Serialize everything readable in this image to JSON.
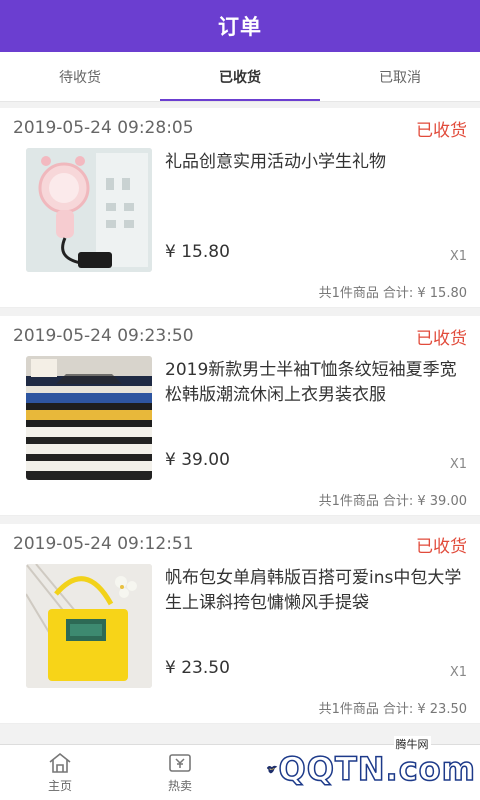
{
  "header": {
    "title": "订单"
  },
  "tabs": [
    {
      "label": "待收货",
      "active": false
    },
    {
      "label": "已收货",
      "active": true
    },
    {
      "label": "已取消",
      "active": false
    }
  ],
  "orders": [
    {
      "time": "2019-05-24 09:28:05",
      "status": "已收货",
      "product_name": "礼品创意实用活动小学生礼物",
      "price": "¥ 15.80",
      "quantity": "X1",
      "summary_count": "共1件商品",
      "summary_total": "合计: ¥ 15.80",
      "image": "usb-fan-product-icon"
    },
    {
      "time": "2019-05-24 09:23:50",
      "status": "已收货",
      "product_name": "2019新款男士半袖T恤条纹短袖夏季宽松韩版潮流休闲上衣男装衣服",
      "price": "¥ 39.00",
      "quantity": "X1",
      "summary_count": "共1件商品",
      "summary_total": "合计: ¥ 39.00",
      "image": "striped-tshirts-product-icon"
    },
    {
      "time": "2019-05-24 09:12:51",
      "status": "已收货",
      "product_name": "帆布包女单肩韩版百搭可爱ins中包大学生上课斜挎包慵懒风手提袋",
      "price": "¥ 23.50",
      "quantity": "X1",
      "summary_count": "共1件商品",
      "summary_total": "合计: ¥ 23.50",
      "image": "yellow-bag-product-icon"
    }
  ],
  "bottom_nav": [
    {
      "label": "主页",
      "icon": "home-icon"
    },
    {
      "label": "热卖",
      "icon": "hot-sale-icon"
    }
  ],
  "watermark": {
    "cn": "腾牛网",
    "en": "QQTN.com"
  },
  "colors": {
    "primary": "#6b3ed0",
    "status": "#e14b3b"
  }
}
